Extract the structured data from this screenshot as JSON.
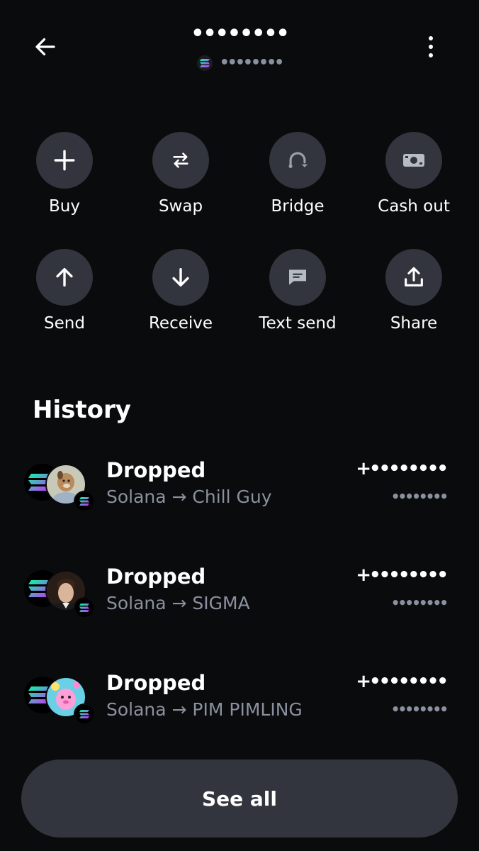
{
  "header": {
    "title": "••••••••",
    "subtitle": "••••••••"
  },
  "actions": [
    {
      "label": "Buy",
      "icon": "plus-icon"
    },
    {
      "label": "Swap",
      "icon": "swap-icon"
    },
    {
      "label": "Bridge",
      "icon": "bridge-icon"
    },
    {
      "label": "Cash out",
      "icon": "cash-icon"
    },
    {
      "label": "Send",
      "icon": "arrow-up-icon"
    },
    {
      "label": "Receive",
      "icon": "arrow-down-icon"
    },
    {
      "label": "Text send",
      "icon": "message-icon"
    },
    {
      "label": "Share",
      "icon": "share-icon"
    }
  ],
  "history": {
    "title": "History",
    "items": [
      {
        "title": "Dropped",
        "subtitle": "Solana → Chill Guy",
        "amount": "+••••••••",
        "value": "••••••••"
      },
      {
        "title": "Dropped",
        "subtitle": "Solana → SIGMA",
        "amount": "+••••••••",
        "value": "••••••••"
      },
      {
        "title": "Dropped",
        "subtitle": "Solana → PIM PIMLING",
        "amount": "+••••••••",
        "value": "••••••••"
      }
    ]
  },
  "see_all_label": "See all",
  "colors": {
    "background": "#0a0b0d",
    "button": "#32353d",
    "muted_text": "#8a919e"
  }
}
